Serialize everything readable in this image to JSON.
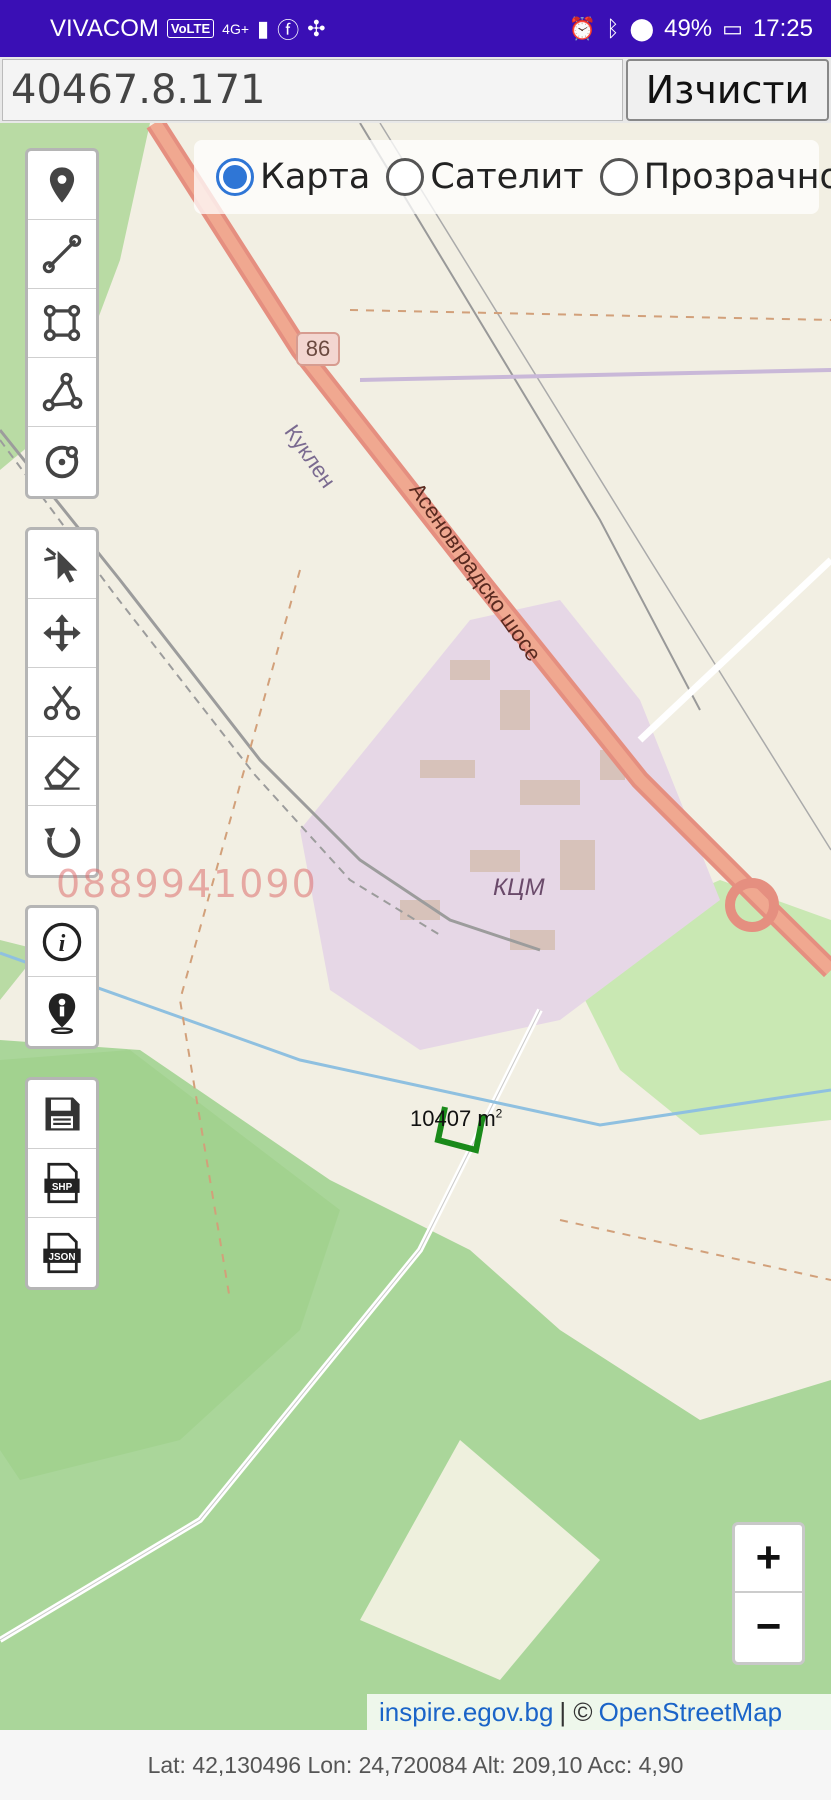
{
  "status_bar": {
    "carrier": "VIVACOM",
    "volte": "VoLTE",
    "network": "4G+",
    "battery": "49%",
    "time": "17:25"
  },
  "top_bar": {
    "search_value": "40467.8.171",
    "clear_label": "Изчисти"
  },
  "layers": {
    "options": [
      "Карта",
      "Сателит",
      "Прозрачно"
    ],
    "selected": "Карта"
  },
  "toolbar": {
    "draw_tools": [
      "point-marker",
      "line",
      "polygon",
      "angle-measure",
      "circle"
    ],
    "edit_tools": [
      "select-pointer",
      "move",
      "cut",
      "eraser",
      "undo"
    ],
    "info_tools": [
      "info",
      "person-location"
    ],
    "export_tools": [
      "save",
      "export-shp",
      "export-json"
    ]
  },
  "map": {
    "road_number": "86",
    "road_name": "Асеновградско шосе",
    "village": "Куклен",
    "area_name": "КЦМ",
    "watermark": "0889941090",
    "area_value": "10407",
    "area_unit": "m",
    "area_exp": "2"
  },
  "zoom": {
    "in": "+",
    "out": "−"
  },
  "attribution": {
    "source1": "inspire.egov.bg",
    "separator": "| ©",
    "source2": "OpenStreetMap"
  },
  "footer": {
    "gps": "Lat: 42,130496 Lon: 24,720084 Alt: 209,10 Acc: 4,90"
  }
}
